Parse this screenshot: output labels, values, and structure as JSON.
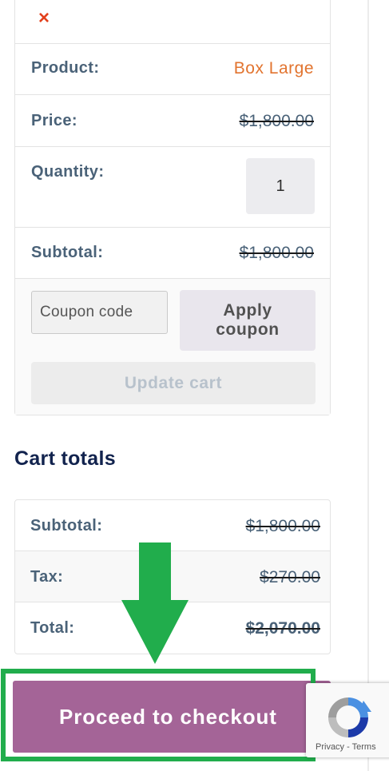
{
  "cart": {
    "remove_icon": "×",
    "product": {
      "label": "Product:",
      "value": "Box Large"
    },
    "price": {
      "label": "Price:",
      "value": "$1,800.00"
    },
    "quantity": {
      "label": "Quantity:",
      "value": "1"
    },
    "subtotal": {
      "label": "Subtotal:",
      "value": "$1,800.00"
    },
    "coupon": {
      "placeholder": "Coupon code",
      "apply_label": "Apply coupon"
    },
    "update_label": "Update cart"
  },
  "totals": {
    "heading": "Cart totals",
    "subtotal": {
      "label": "Subtotal:",
      "value": "$1,800.00"
    },
    "tax": {
      "label": "Tax:",
      "value": "$270.00"
    },
    "total": {
      "label": "Total:",
      "value": "$2,070.00"
    }
  },
  "checkout": {
    "label": "Proceed to checkout"
  },
  "recaptcha": {
    "privacy": "Privacy",
    "separator": "-",
    "terms": "Terms"
  },
  "colors": {
    "accent": "#a46497",
    "highlight": "#21ad4c",
    "product_link": "#e2742f",
    "remove": "#e2401c",
    "heading": "#12234e"
  },
  "icons": {
    "remove": "close-icon",
    "arrow": "arrow-down-icon",
    "recaptcha": "recaptcha-logo-icon"
  }
}
